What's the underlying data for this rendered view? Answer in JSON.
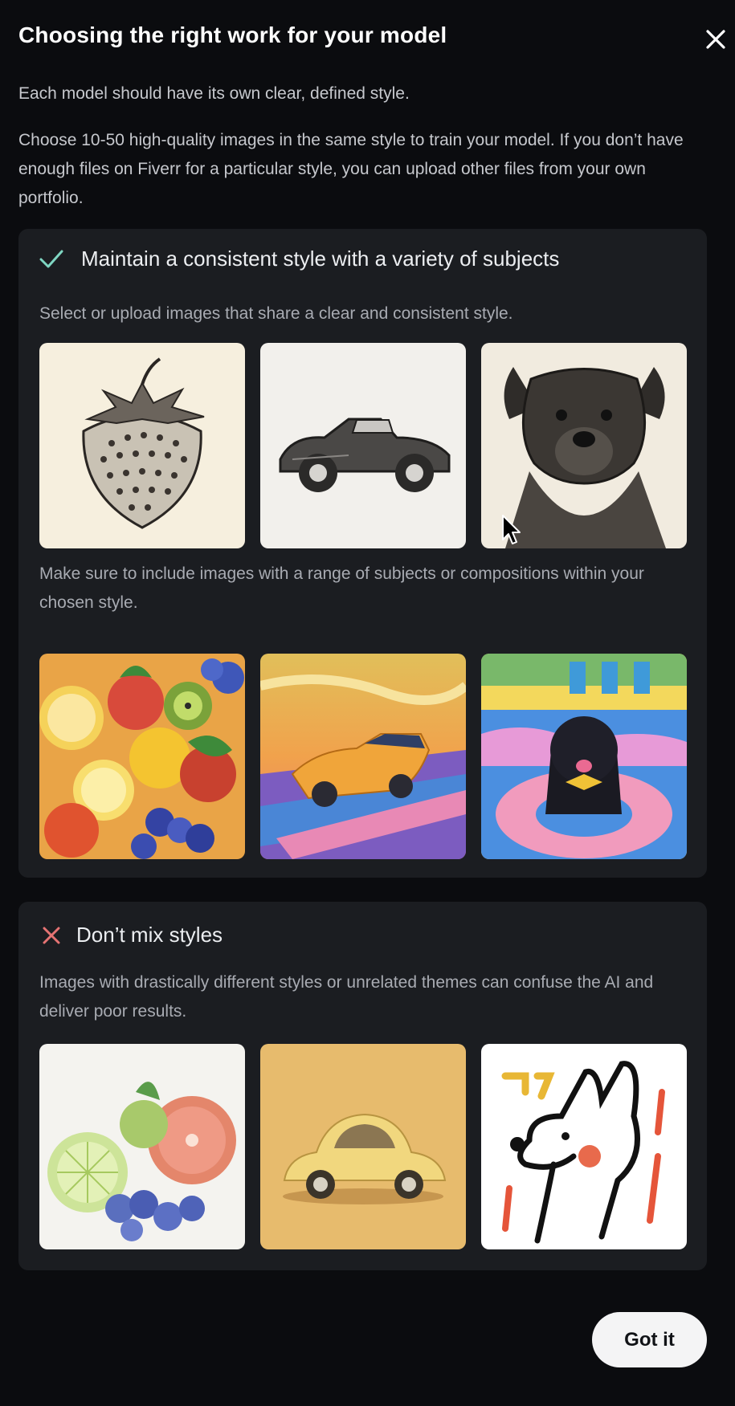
{
  "dialog": {
    "title": "Choosing the right work for your model",
    "intro_1": "Each model should have its own clear, defined style.",
    "intro_2": "Choose 10-50 high-quality images in the same style to train your model. If you don’t have enough files on Fiverr for a particular style, you can upload other files from your own portfolio.",
    "close_icon": "close-icon"
  },
  "good_card": {
    "icon": "check-icon",
    "heading": "Maintain a consistent style with a variety of subjects",
    "text_1": "Select or upload images that share a clear and consistent style.",
    "row_1": [
      "Pencil sketch of strawberry",
      "Pencil sketch of vintage car",
      "Pencil sketch of dog"
    ],
    "text_2": "Make sure to include images with a range of subjects or compositions within your chosen style.",
    "row_2": [
      "Painted fruits",
      "Painted sports car",
      "Painted dog in pool float"
    ]
  },
  "bad_card": {
    "icon": "x-icon",
    "heading": "Don’t mix styles",
    "text": "Images with drastically different styles or unrelated themes can confuse the AI and deliver poor results.",
    "row": [
      "Watercolor fruits",
      "3D render yellow car",
      "Line drawing dog"
    ]
  },
  "footer": {
    "got_it_label": "Got it"
  },
  "colors": {
    "background": "#0b0c0f",
    "card": "#1b1d21",
    "check": "#7fd6c2",
    "cross": "#e57373",
    "button_bg": "#f4f4f5"
  }
}
